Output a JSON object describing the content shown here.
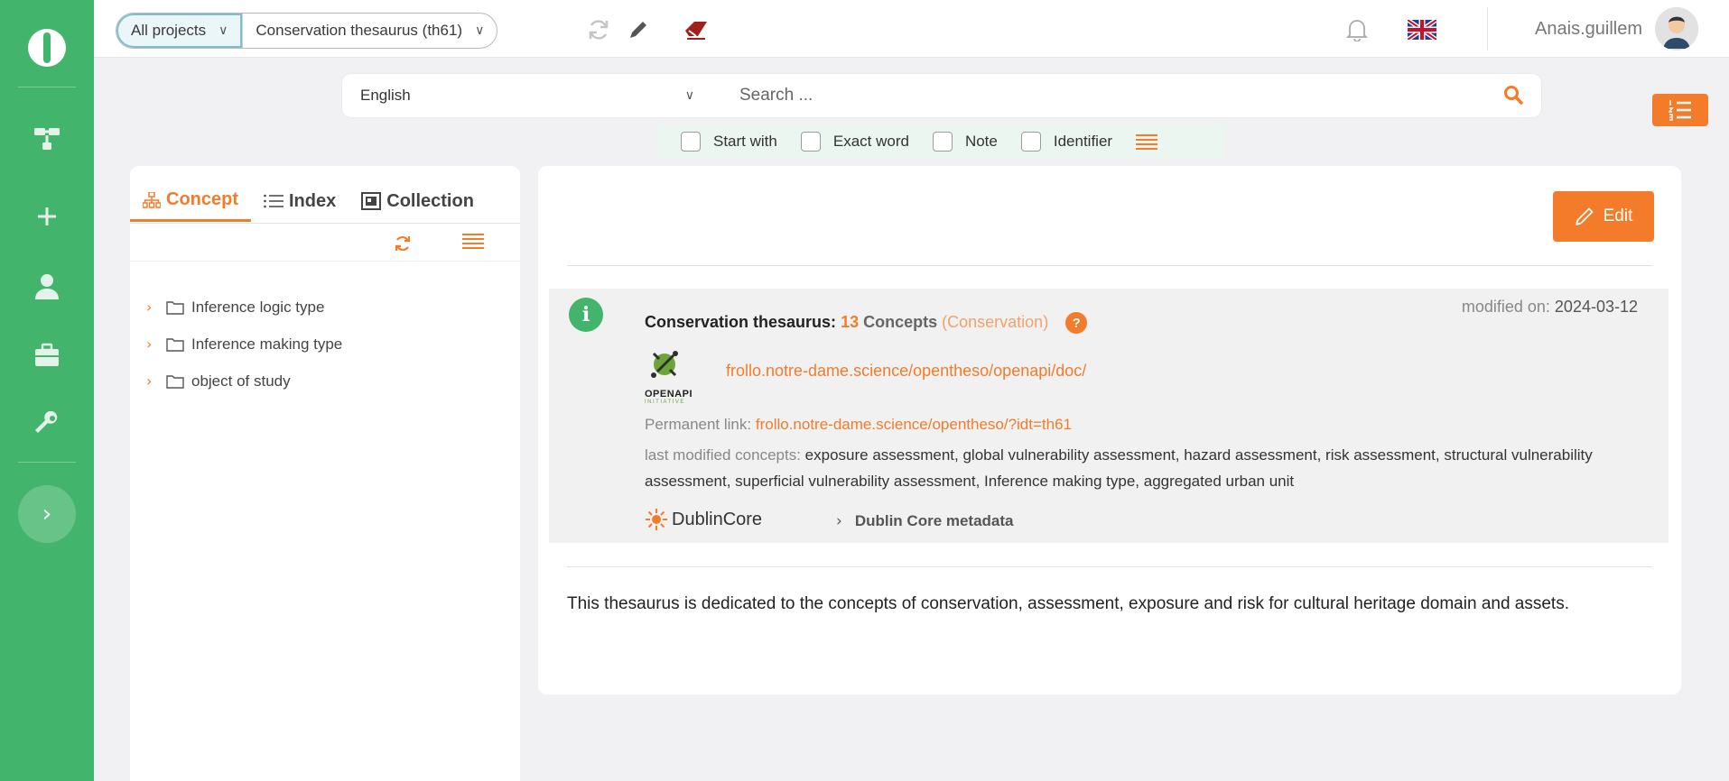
{
  "topbar": {
    "project_selector": "All projects",
    "thesaurus_selector": "Conservation thesaurus (th61)",
    "user_name": "Anais.guillem"
  },
  "search": {
    "language": "English",
    "placeholder": "Search ...",
    "filters": [
      {
        "label": "Start with"
      },
      {
        "label": "Exact word"
      },
      {
        "label": "Note"
      },
      {
        "label": "Identifier"
      }
    ]
  },
  "left_panel": {
    "tabs": [
      {
        "label": "Concept"
      },
      {
        "label": "Index"
      },
      {
        "label": "Collection"
      }
    ],
    "tree": [
      {
        "label": "Inference logic type"
      },
      {
        "label": "Inference making type"
      },
      {
        "label": "object of study"
      }
    ]
  },
  "main": {
    "edit_label": "Edit",
    "info": {
      "modified_label": "modified on:",
      "modified_value": "2024-03-12",
      "thesaurus_name": "Conservation thesaurus:",
      "concept_count": "13",
      "concepts_word": "Concepts",
      "group": "(Conservation)",
      "openapi_link": "frollo.notre-dame.science/opentheso/openapi/doc/",
      "openapi_label": "OPENAPI",
      "openapi_sub": "INITIATIVE",
      "permanent_label": "Permanent link:",
      "permanent_value": "frollo.notre-dame.science/opentheso/?idt=th61",
      "last_modified_label": "last modified concepts:",
      "last_modified_list": "exposure assessment, global vulnerability assessment, hazard assessment, risk assessment, structural vulnerability assessment, superficial vulnerability assessment, Inference making type, aggregated urban unit",
      "dublincore_label": "DublinCore",
      "dublincore_metadata": "Dublin Core metadata"
    },
    "description": "This thesaurus is dedicated to the concepts of conservation, assessment, exposure and risk for cultural heritage domain and assets."
  },
  "colors": {
    "brand_green": "#43b46b",
    "accent_orange": "#f47b2a"
  }
}
